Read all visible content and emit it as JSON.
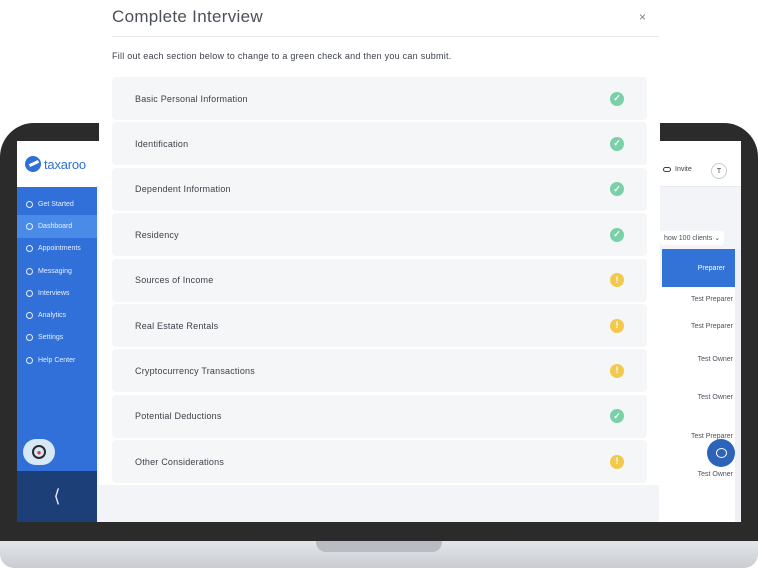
{
  "modal": {
    "title": "Complete Interview",
    "close_glyph": "×",
    "subtitle": "Fill out each section below to change to a green check and then you can submit.",
    "sections": [
      {
        "label": "Basic Personal Information",
        "status": "complete",
        "icon": "check-icon"
      },
      {
        "label": "Identification",
        "status": "complete",
        "icon": "check-icon"
      },
      {
        "label": "Dependent Information",
        "status": "complete",
        "icon": "check-icon"
      },
      {
        "label": "Residency",
        "status": "complete",
        "icon": "check-icon"
      },
      {
        "label": "Sources of Income",
        "status": "incomplete",
        "icon": "warning-icon"
      },
      {
        "label": "Real Estate Rentals",
        "status": "incomplete",
        "icon": "warning-icon"
      },
      {
        "label": "Cryptocurrency Transactions",
        "status": "incomplete",
        "icon": "warning-icon"
      },
      {
        "label": "Potential Deductions",
        "status": "complete",
        "icon": "check-icon"
      },
      {
        "label": "Other Considerations",
        "status": "incomplete",
        "icon": "warning-icon"
      }
    ],
    "check_glyph": "✓",
    "warn_glyph": "!"
  },
  "app": {
    "brand": "taxaroo",
    "nav": [
      {
        "label": "Get Started",
        "icon": "lightbulb-icon",
        "active": false
      },
      {
        "label": "Dashboard",
        "icon": "dashboard-icon",
        "active": true
      },
      {
        "label": "Appointments",
        "icon": "calendar-icon",
        "active": false
      },
      {
        "label": "Messaging",
        "icon": "message-icon",
        "active": false
      },
      {
        "label": "Interviews",
        "icon": "pencil-icon",
        "active": false
      },
      {
        "label": "Analytics",
        "icon": "chart-icon",
        "active": false
      },
      {
        "label": "Settings",
        "icon": "gear-icon",
        "active": false
      },
      {
        "label": "Help Center",
        "icon": "info-icon",
        "active": false
      }
    ],
    "sidebar_toggle_glyph": "⟨",
    "header": {
      "invite_label": "Invite",
      "avatar_initial": "T"
    },
    "show_clients": "how 100 clients ⌄",
    "table_header": "Preparer",
    "cells": [
      "Test Preparer",
      "Test Preparer",
      "Test Owner",
      "Test Owner",
      "Test Preparer",
      "Test Owner"
    ]
  },
  "colors": {
    "complete": "#7ad1a7",
    "incomplete": "#f2c94c",
    "sidebar": "#3070d8",
    "brand": "#2f6fd6"
  }
}
